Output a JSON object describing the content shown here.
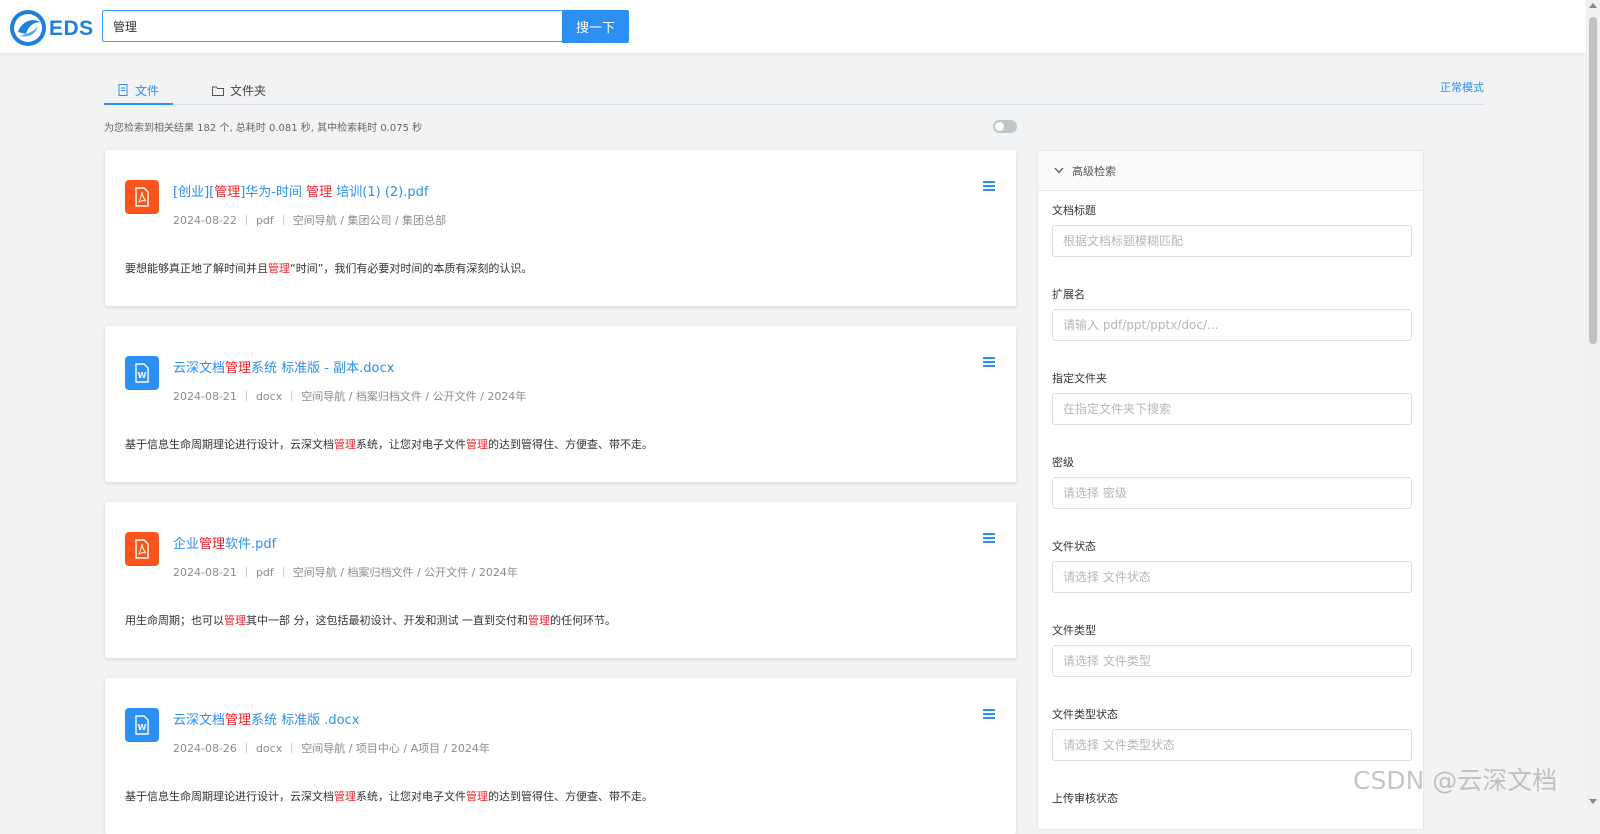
{
  "header": {
    "logo_text": "EDS",
    "search_value": "管理",
    "search_button": "搜一下"
  },
  "tabs": [
    {
      "label": "文件",
      "active": true
    },
    {
      "label": "文件夹",
      "active": false
    }
  ],
  "mode_link": "正常模式",
  "result_stats": "为您检索到相关结果 182 个, 总耗时 0.081 秒, 其中检索耗时 0.075 秒",
  "results": [
    {
      "type": "pdf",
      "title_parts": [
        "[创业][",
        "管理",
        "]华为-时间 ",
        "管理",
        " 培训(1) (2).pdf"
      ],
      "date": "2024-08-22",
      "ext": "pdf",
      "path": "空间导航 / 集团公司 / 集团总部",
      "snippet_parts": [
        "要想能够真正地了解时间并且",
        "管理",
        "“时间”，我们有必要对时间的本质有深刻的认识。"
      ]
    },
    {
      "type": "docx",
      "title_parts": [
        "云深文档",
        "管理",
        "系统 标准版 - 副本.docx"
      ],
      "date": "2024-08-21",
      "ext": "docx",
      "path": "空间导航 / 档案归档文件 / 公开文件 / 2024年",
      "snippet_parts": [
        "基于信息生命周期理论进行设计，云深文档",
        "管理",
        "系统，让您对电子文件",
        "管理",
        "的达到管得住、方便查、带不走。"
      ]
    },
    {
      "type": "pdf",
      "title_parts": [
        "企业",
        "管理",
        "软件.pdf"
      ],
      "date": "2024-08-21",
      "ext": "pdf",
      "path": "空间导航 / 档案归档文件 / 公开文件 / 2024年",
      "snippet_parts": [
        "用生命周期；也可以",
        "管理",
        "其中一部 分，这包括最初设计、开发和测试 一直到交付和",
        "管理",
        "的任何环节。"
      ]
    },
    {
      "type": "docx",
      "title_parts": [
        "云深文档",
        "管理",
        "系统 标准版 .docx"
      ],
      "date": "2024-08-26",
      "ext": "docx",
      "path": "空间导航 / 项目中心 / A项目 / 2024年",
      "snippet_parts": [
        "基于信息生命周期理论进行设计，云深文档",
        "管理",
        "系统，让您对电子文件",
        "管理",
        "的达到管得住、方便查、带不走。"
      ]
    }
  ],
  "advanced": {
    "title": "高级检索",
    "fields": [
      {
        "label": "文档标题",
        "placeholder": "根据文档标题模糊匹配"
      },
      {
        "label": "扩展名",
        "placeholder": "请输入 pdf/ppt/pptx/doc/..."
      },
      {
        "label": "指定文件夹",
        "placeholder": "在指定文件夹下搜索"
      },
      {
        "label": "密级",
        "placeholder": "请选择 密级"
      },
      {
        "label": "文件状态",
        "placeholder": "请选择 文件状态"
      },
      {
        "label": "文件类型",
        "placeholder": "请选择 文件类型"
      },
      {
        "label": "文件类型状态",
        "placeholder": "请选择 文件类型状态"
      },
      {
        "label": "上传审核状态",
        "placeholder": ""
      }
    ]
  },
  "watermark": "CSDN @云深文档",
  "colors": {
    "accent": "#2b8ff3",
    "highlight": "#f5222d",
    "pdf": "#fa541c",
    "docx": "#2b8ff3"
  }
}
